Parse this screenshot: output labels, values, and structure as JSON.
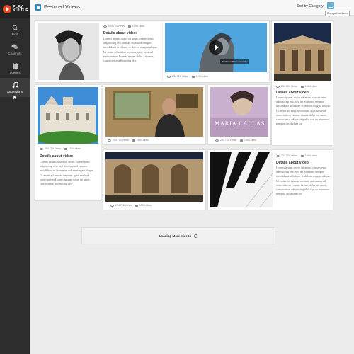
{
  "app": {
    "logo_line1": "PLAY",
    "logo_line2": "KULTUR",
    "brand_color": "#e14b1f"
  },
  "sidebar": {
    "items": [
      {
        "label": "Find",
        "icon": "search-icon"
      },
      {
        "label": "Channels",
        "icon": "channels-icon"
      },
      {
        "label": "Scenes",
        "icon": "scenes-icon"
      },
      {
        "label": "Sugestions",
        "icon": "music-note-icon",
        "active": true
      }
    ]
  },
  "header": {
    "title": "Featured Videos",
    "sort_label": "Sort by Category:",
    "tooltip": "Enlarged list items"
  },
  "cards": [
    {
      "views": "204 724 Views",
      "likes": "1094 Likes",
      "details_title": "Details about video:",
      "description": "Lorem ipsum dolor sit amet, consectetur adipiscing elit, sed do eiusmod tempor incididunt ut labore et dolore magna aliqua. Ut enim ad minim veniam, quis nostrud exercitation Lorem ipsum dolor sit amet, consectetur adipiscing elit."
    },
    {
      "views": "204 724 Views",
      "likes": "1094 Likes",
      "video_caption": "Beethoven Piano Concerto"
    },
    {
      "views": "204 724 Views",
      "likes": "1094 Likes",
      "details_title": "Details about video:",
      "description": "Lorem ipsum dolor sit amet, consectetur adipiscing elit, sed do eiusmod tempor incididunt ut labore et dolore magna aliqua. Ut enim ad minim veniam, quis nostrud exercitation Lorem ipsum dolor sit amet, consectetur adipiscing elit, sed do eiusmod tempor incididunt ut"
    },
    {
      "views": "204 724 Views",
      "likes": "1094 Likes"
    },
    {
      "views": "204 724 Views",
      "likes": "1094 Likes",
      "poster_title": "MARIA CALLAS"
    },
    {
      "views": "204 724 Views",
      "likes": "1094 Likes",
      "details_title": "Details about video:",
      "description": "Lorem ipsum dolor sit amet, consectetur adipiscing elit, sed do eiusmod tempor incididunt ut labore et dolore magna aliqua. Ut enim ad minim veniam, quis nostrud exercitation Lorem ipsum dolor sit amet, consectetur adipiscing elit, sed do eiusmod tempor incididunt ut"
    },
    {
      "views": "204 724 Views",
      "likes": "1094 Likes"
    },
    {
      "views": "204 724 Views",
      "likes": "1094 Likes",
      "details_title": "Details about video:",
      "description": "Lorem ipsum dolor sit amet, consectetur adipiscing elit, sed do eiusmod tempor incididunt ut labore et dolore magna aliqua. Ut enim ad minim veniam, quis nostrud exercitation Lorem ipsum dolor sit amet, consectetur adipiscing elit, sed do eiusmod tempor incididunt ut"
    }
  ],
  "loading": {
    "label": "Loading More Videos"
  }
}
